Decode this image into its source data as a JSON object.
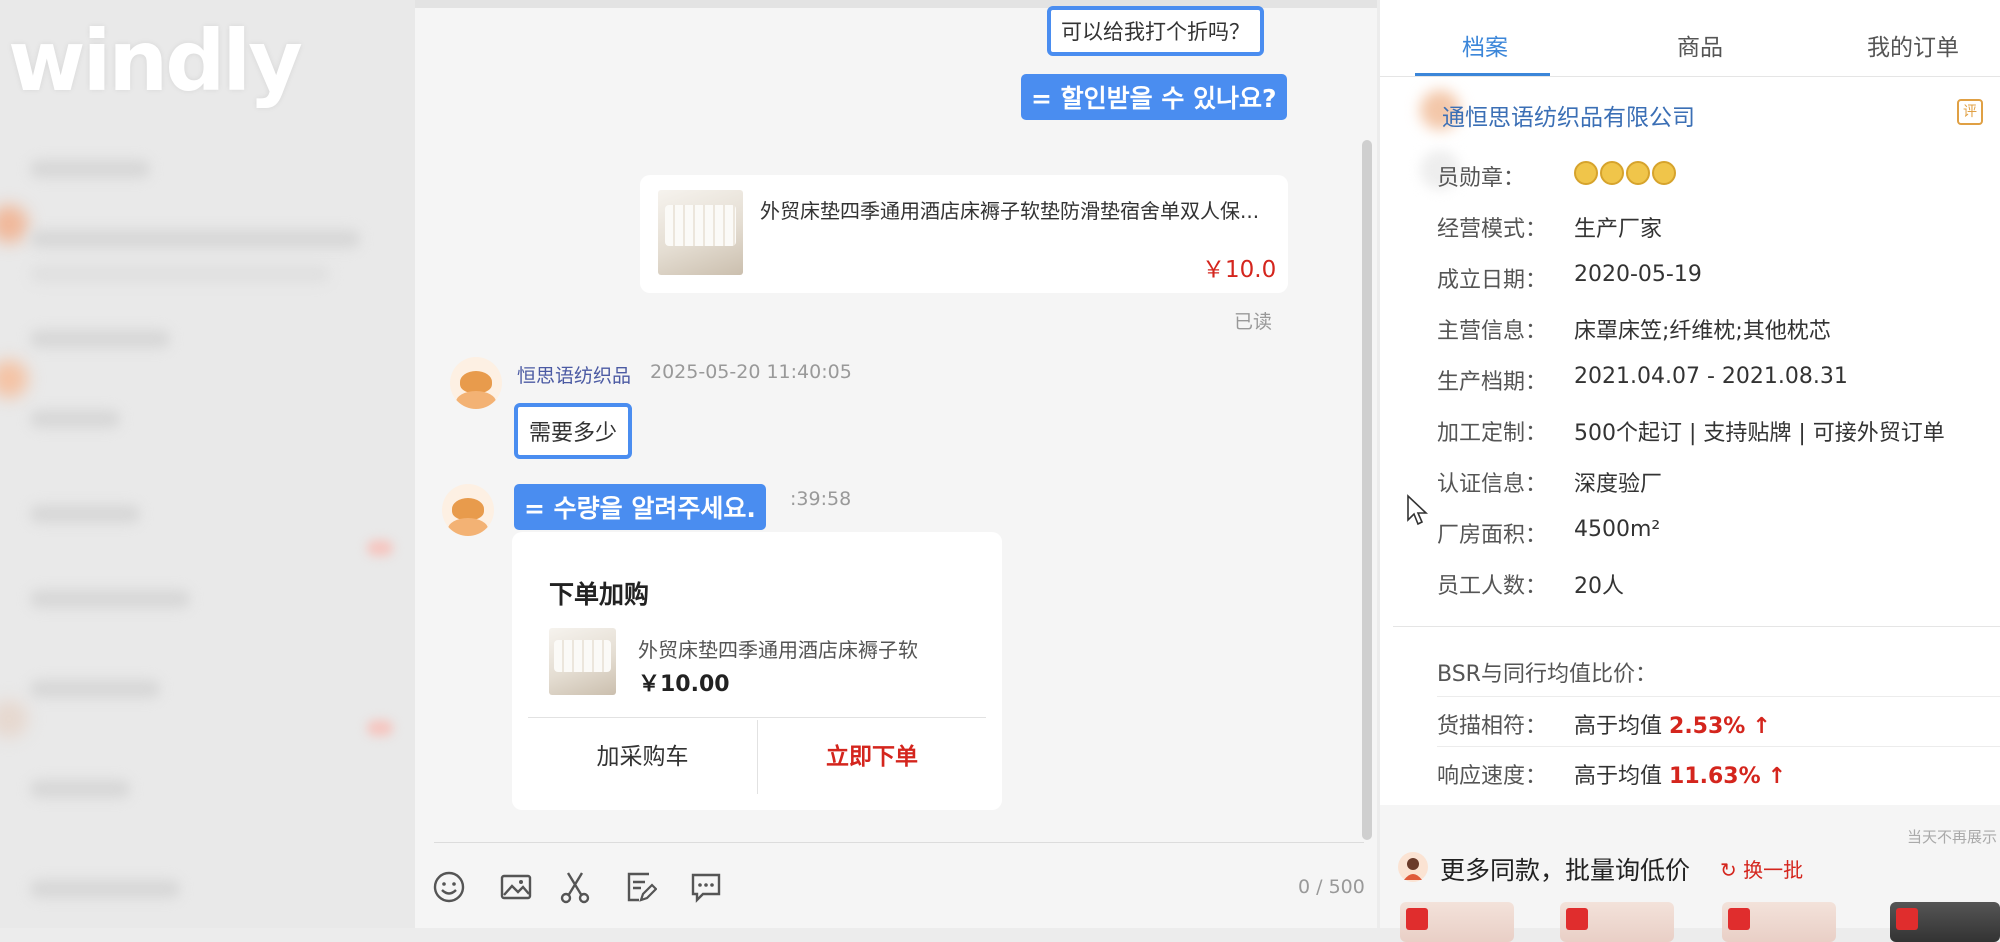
{
  "logo": "windly",
  "chat": {
    "top_bubble": "可以给我打个折吗？",
    "caption_1": "= 할인받을 수 있나요?",
    "product_card": {
      "title": "外贸床垫四季通用酒店床褥子软垫防滑垫宿舍单双人保...",
      "price": "￥10.0",
      "read_status": "已读"
    },
    "message_sender": "恒思语纺织品",
    "message_time": "2025-05-20 11:40:05",
    "reply_bubble": "需要多少",
    "second_time": ":39:58",
    "caption_2": "= 수량을 알려주세요.",
    "order_card": {
      "title": "下单加购",
      "product_name": "外贸床垫四季通用酒店床褥子软",
      "price": "￥10.00",
      "add_cart": "加采购车",
      "buy_now": "立即下单"
    },
    "char_count": "0 / 500",
    "toolbar_icons": [
      "emoji-icon",
      "image-icon",
      "scissors-icon",
      "edit-note-icon",
      "chat-bubble-icon"
    ]
  },
  "profile": {
    "tabs": [
      "档案",
      "商品",
      "我的订单"
    ],
    "active_tab": "档案",
    "company": "通恒思语纺织品有限公司",
    "verified_badge": "评",
    "rows": [
      {
        "label": "员勋章：",
        "value": ""
      },
      {
        "label": "经营模式：",
        "value": "生产厂家"
      },
      {
        "label": "成立日期：",
        "value": "2020-05-19"
      },
      {
        "label": "主营信息：",
        "value": "床罩床笠;纤维枕;其他枕芯"
      },
      {
        "label": "生产档期：",
        "value": "2021.04.07 - 2021.08.31"
      },
      {
        "label": "加工定制：",
        "value": "500个起订 | 支持贴牌 | 可接外贸订单"
      },
      {
        "label": "认证信息：",
        "value": "深度验厂"
      },
      {
        "label": "厂房面积：",
        "value": "4500m²"
      },
      {
        "label": "员工人数：",
        "value": "20人"
      }
    ],
    "bsr_title": "BSR与同行均值比价：",
    "bsr": [
      {
        "label": "货描相符：",
        "prefix": "高于均值",
        "value": "2.53%",
        "arrow": "↑"
      },
      {
        "label": "响应速度：",
        "prefix": "高于均值",
        "value": "11.63%",
        "arrow": "↑"
      }
    ],
    "hint": "当天不再展示",
    "more_title": "更多同款，批量询低价",
    "refresh": "换一批",
    "collapse_icon": "»",
    "accent": "#3b86d9",
    "price_red": "#d4251d"
  }
}
